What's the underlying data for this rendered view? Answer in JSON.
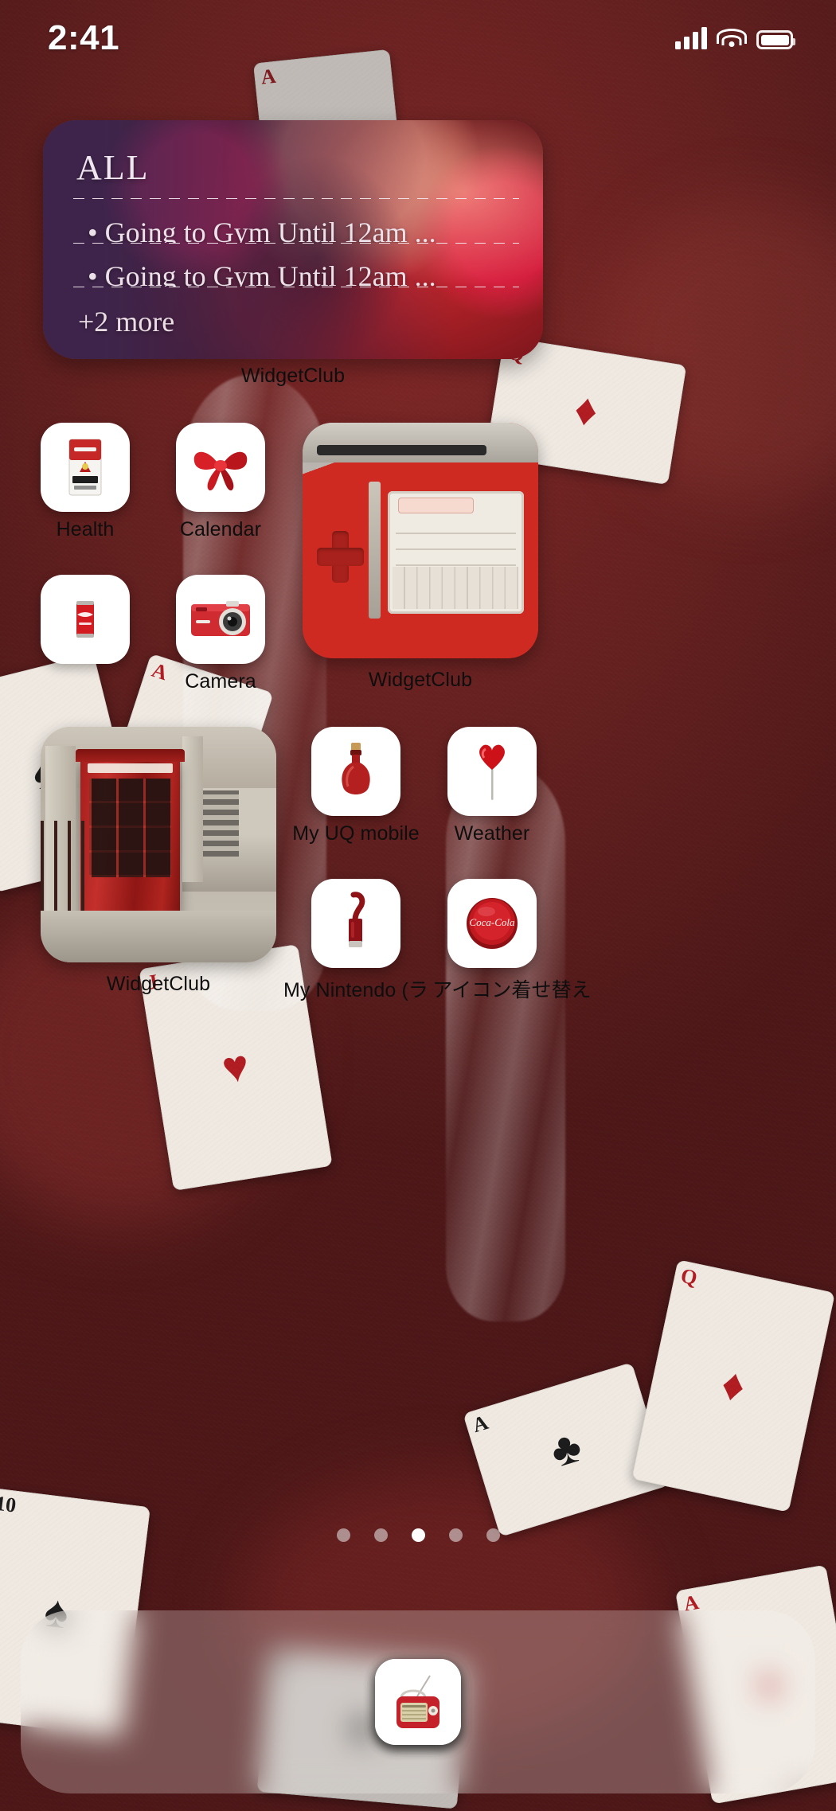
{
  "status_bar": {
    "time": "2:41",
    "cellular_icon": "signal-bars-icon",
    "wifi_icon": "wifi-icon",
    "battery_icon": "battery-icon"
  },
  "widgets": {
    "todo": {
      "title": "ALL",
      "tasks": [
        "• Going to Gym Until 12am ...",
        "• Going to Gym Until 12am ..."
      ],
      "more_label": "+2 more",
      "app_label": "WidgetClub"
    },
    "photo_ds": {
      "app_label": "WidgetClub"
    },
    "photo_booth": {
      "app_label": "WidgetClub"
    }
  },
  "apps": {
    "row1": [
      {
        "label": "Health",
        "icon": "cigarette-pack-icon"
      },
      {
        "label": "Calendar",
        "icon": "red-bow-icon"
      }
    ],
    "row2": [
      {
        "label": "",
        "icon": "coca-cola-can-icon"
      },
      {
        "label": "Camera",
        "icon": "red-camera-icon"
      }
    ],
    "row3": [
      {
        "label": "My UQ mobile",
        "icon": "red-glass-bottle-icon"
      },
      {
        "label": "Weather",
        "icon": "heart-lollipop-icon"
      }
    ],
    "row4": [
      {
        "label": "My Nintendo (ラ",
        "icon": "red-lipstick-icon"
      },
      {
        "label": "アイコン着せ替え",
        "icon": "coca-cola-cap-icon"
      }
    ]
  },
  "dock": {
    "items": [
      {
        "label": "",
        "icon": "red-rotary-phone-icon"
      },
      {
        "label": "",
        "icon": "gramophone-icon"
      },
      {
        "label": "",
        "icon": "heart-button-icon"
      },
      {
        "label": "",
        "icon": "red-radio-icon"
      }
    ]
  },
  "page_indicator": {
    "total": 5,
    "active_index": 3
  },
  "colors": {
    "wallpaper_red": "#6e2222",
    "icon_tile": "#ffffff",
    "label_text": "#0e0e0e",
    "widget_purple": "#5c4a86",
    "accent_red": "#c4262c"
  }
}
